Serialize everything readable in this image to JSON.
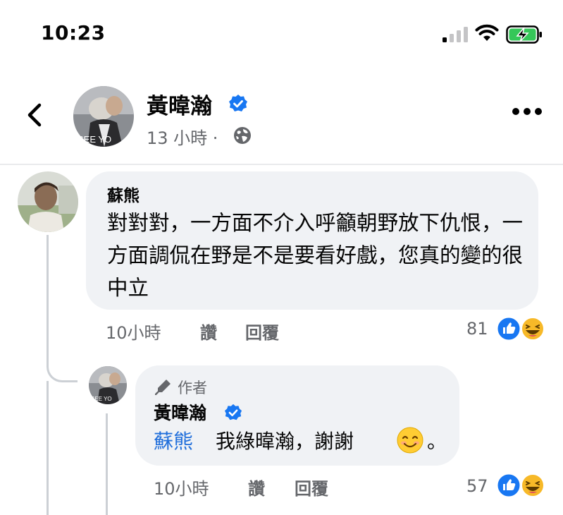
{
  "status_bar": {
    "time": "10:23"
  },
  "post_header": {
    "author": "黃暐瀚",
    "meta": "13 小時 ·",
    "avatar_overlay_text": "SEE YO"
  },
  "comments": [
    {
      "author": "蘇熊",
      "text": "對對對，一方面不介入呼籲朝野放下仇恨，一方面調侃在野是不是要看好戲，您真的變的很中立",
      "time": "10小時",
      "like_label": "讚",
      "reply_label": "回覆",
      "reaction_count": "81"
    }
  ],
  "reply": {
    "badge": "作者",
    "author": "黃暐瀚",
    "mention": "蘇熊",
    "text": "我綠暐瀚，謝謝",
    "end_punct": "。",
    "time": "10小時",
    "like_label": "讚",
    "reply_label": "回覆",
    "reaction_count": "57"
  },
  "colors": {
    "verified_blue": "#1877f2",
    "mention_blue": "#216fdb",
    "bubble_bg": "#f0f2f5",
    "meta_gray": "#65676b"
  },
  "icons": [
    "signal-icon",
    "wifi-icon",
    "battery-charging-icon",
    "back-arrow-icon",
    "verified-badge-icon",
    "globe-icon",
    "more-options-icon",
    "pen-icon",
    "like-reaction-icon",
    "haha-reaction-icon",
    "smiling-face-emoji"
  ]
}
